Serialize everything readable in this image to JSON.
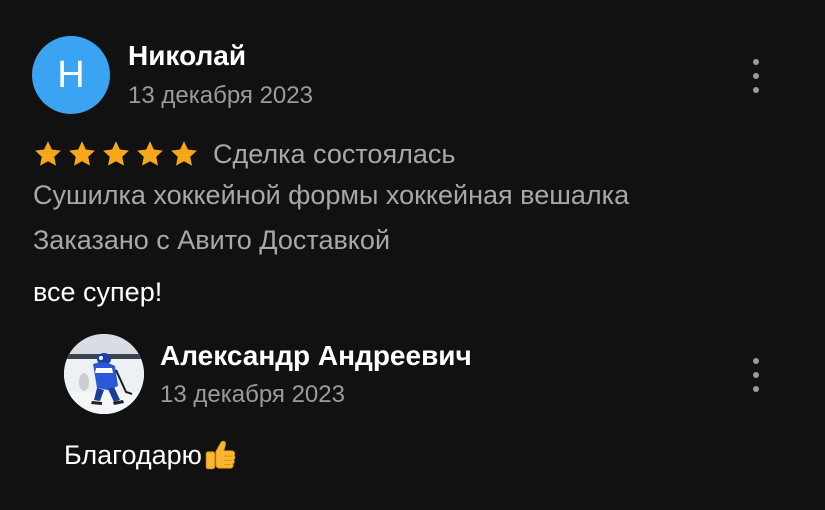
{
  "review": {
    "author_initial": "Н",
    "author_name": "Николай",
    "date": "13 декабря 2023",
    "rating": 5,
    "rating_max": 5,
    "deal_status": "Сделка состоялась",
    "item_title": "Сушилка хоккейной формы хоккейная вешалка",
    "delivery": "Заказано с Авито Доставкой",
    "text": "все супер!"
  },
  "reply": {
    "author_name": "Александр Андреевич",
    "date": "13 декабря 2023",
    "text": "Благодарю"
  },
  "icons": {
    "avatar_color": "#3aa3f2",
    "star_color": "#f7a81a",
    "menu_icon": "more-vertical-icon",
    "reply_emoji": "thumbs-up-icon"
  }
}
